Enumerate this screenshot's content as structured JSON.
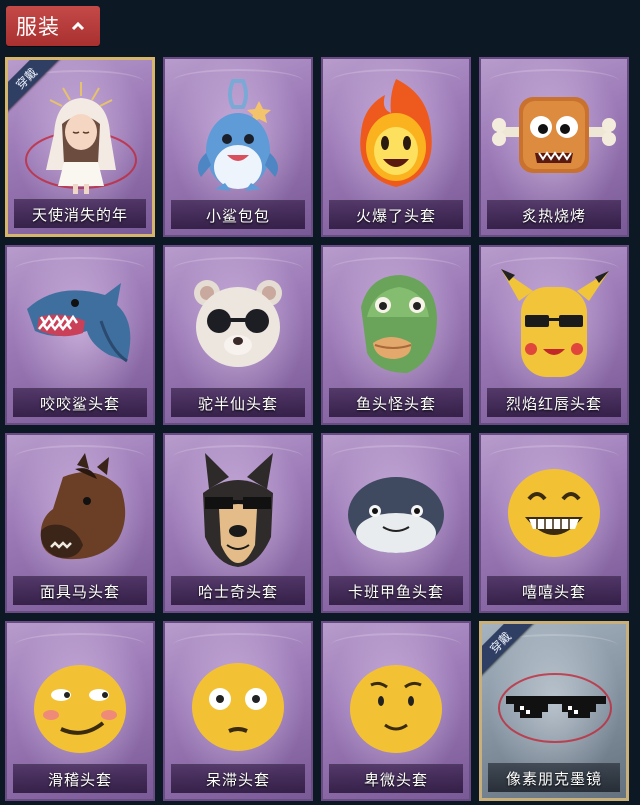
{
  "header": {
    "title": "服装",
    "chevron_icon": "chevron-up-icon"
  },
  "items": [
    {
      "label": "天使消失的年",
      "icon": "angel-girl-icon",
      "badge": "穿戴",
      "worn": true
    },
    {
      "label": "小鲨包包",
      "icon": "shark-bag-icon"
    },
    {
      "label": "火爆了头套",
      "icon": "fire-head-icon"
    },
    {
      "label": "炙热烧烤",
      "icon": "grill-meat-head-icon"
    },
    {
      "label": "咬咬鲨头套",
      "icon": "shark-head-icon"
    },
    {
      "label": "驼半仙头套",
      "icon": "bear-sunglasses-head-icon"
    },
    {
      "label": "鱼头怪头套",
      "icon": "fish-head-icon"
    },
    {
      "label": "烈焰红唇头套",
      "icon": "yellow-creature-head-icon"
    },
    {
      "label": "面具马头套",
      "icon": "horse-head-icon"
    },
    {
      "label": "哈士奇头套",
      "icon": "husky-head-icon"
    },
    {
      "label": "卡班甲鱼头套",
      "icon": "turtle-head-icon"
    },
    {
      "label": "嘻嘻头套",
      "icon": "grin-emoji-head-icon"
    },
    {
      "label": "滑稽头套",
      "icon": "smirk-emoji-head-icon"
    },
    {
      "label": "呆滞头套",
      "icon": "dazed-emoji-head-icon"
    },
    {
      "label": "卑微头套",
      "icon": "timid-emoji-head-icon"
    },
    {
      "label": "像素朋克墨镜",
      "icon": "pixel-sunglasses-icon",
      "badge": "穿戴",
      "worn": true
    }
  ]
}
